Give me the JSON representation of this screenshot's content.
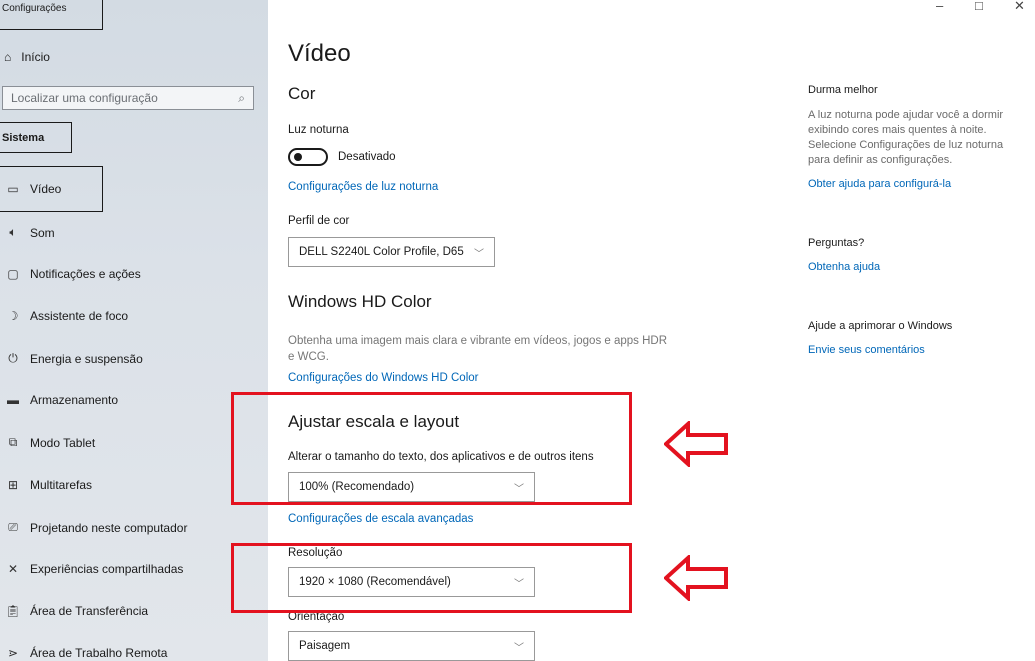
{
  "window": {
    "app_title": "Configurações",
    "minimize": "–",
    "maximize": "□",
    "close": "✕"
  },
  "sidebar": {
    "home_label": "Início",
    "search_placeholder": "Localizar uma configuração",
    "section": "Sistema",
    "items": [
      {
        "label": "Vídeo",
        "icon": "monitor-icon"
      },
      {
        "label": "Som",
        "icon": "speaker-icon"
      },
      {
        "label": "Notificações e ações",
        "icon": "notification-icon"
      },
      {
        "label": "Assistente de foco",
        "icon": "moon-icon"
      },
      {
        "label": "Energia e suspensão",
        "icon": "power-icon"
      },
      {
        "label": "Armazenamento",
        "icon": "storage-icon"
      },
      {
        "label": "Modo Tablet",
        "icon": "tablet-icon"
      },
      {
        "label": "Multitarefas",
        "icon": "multitask-icon"
      },
      {
        "label": "Projetando neste computador",
        "icon": "projection-icon"
      },
      {
        "label": "Experiências compartilhadas",
        "icon": "shared-icon"
      },
      {
        "label": "Área de Transferência",
        "icon": "clipboard-icon"
      },
      {
        "label": "Área de Trabalho Remota",
        "icon": "remote-icon"
      }
    ]
  },
  "main": {
    "title": "Vídeo",
    "color_heading": "Cor",
    "night_light_label": "Luz noturna",
    "night_light_state": "Desativado",
    "night_light_link": "Configurações de luz noturna",
    "color_profile_label": "Perfil de cor",
    "color_profile_value": "DELL S2240L Color Profile, D65",
    "hdr_heading": "Windows HD Color",
    "hdr_desc": "Obtenha uma imagem mais clara e vibrante em vídeos, jogos e apps HDR e WCG.",
    "hdr_link": "Configurações do Windows HD Color",
    "scale_heading": "Ajustar escala e layout",
    "scale_label": "Alterar o tamanho do texto, dos aplicativos e de outros itens",
    "scale_value": "100% (Recomendado)",
    "scale_link": "Configurações de escala avançadas",
    "resolution_label": "Resolução",
    "resolution_value": "1920 × 1080 (Recomendável)",
    "orientation_label": "Orientação",
    "orientation_value": "Paisagem"
  },
  "right_panel": {
    "sleep_heading": "Durma melhor",
    "sleep_text": "A luz noturna pode ajudar você a dormir exibindo cores mais quentes à noite. Selecione Configurações de luz noturna para definir as configurações.",
    "sleep_link": "Obter ajuda para configurá-la",
    "questions_heading": "Perguntas?",
    "questions_link": "Obtenha ajuda",
    "improve_heading": "Ajude a aprimorar o Windows",
    "improve_link": "Envie seus comentários"
  },
  "colors": {
    "highlight": "#e3121f",
    "link": "#0067b8"
  }
}
